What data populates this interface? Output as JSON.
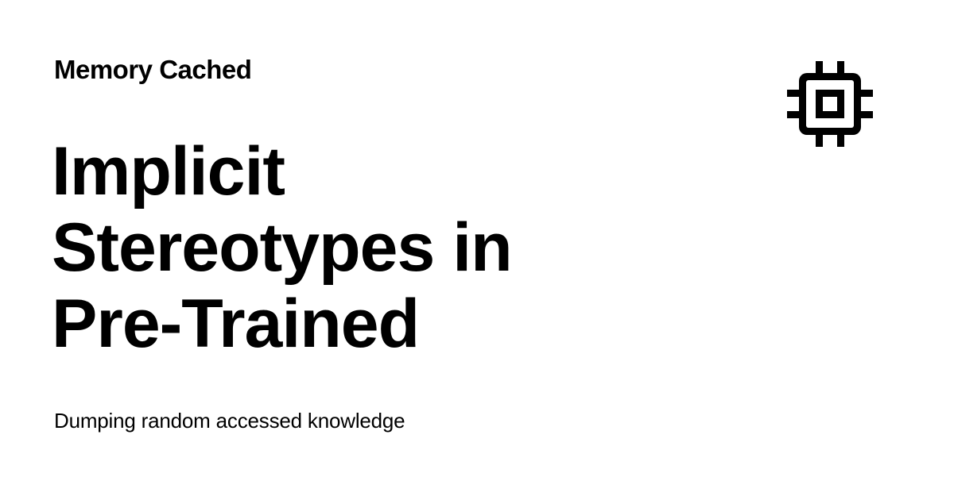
{
  "header": {
    "site_name": "Memory Cached",
    "logo_icon": "cpu-chip-icon"
  },
  "post": {
    "title": "Implicit Stereotypes in Pre-Trained",
    "subtitle": "Dumping random accessed knowledge"
  },
  "colors": {
    "background": "#ffffff",
    "text": "#000000"
  }
}
